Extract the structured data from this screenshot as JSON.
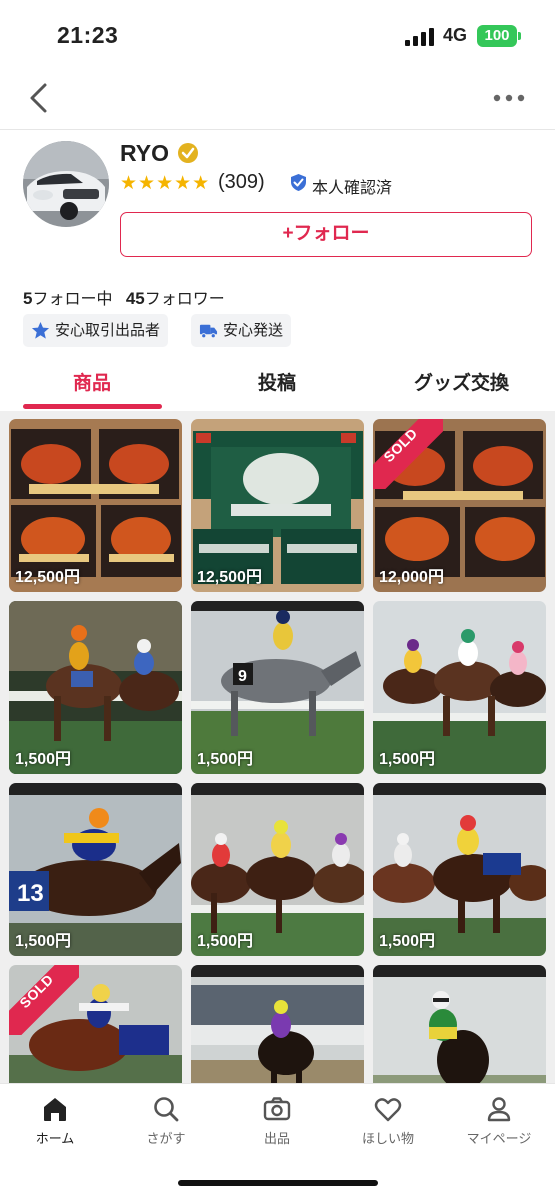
{
  "status_bar": {
    "time": "21:23",
    "network": "4G",
    "battery": "100"
  },
  "profile": {
    "name": "RYO",
    "stars": "★★★★★",
    "review_count": "(309)",
    "identity_label": "本人確認済",
    "follow_button": "+フォロー",
    "following_count": "5",
    "following_label": "フォロー中",
    "follower_count": "45",
    "follower_label": "フォロワー",
    "tags": [
      "安心取引出品者",
      "安心発送"
    ]
  },
  "tabs": [
    "商品",
    "投稿",
    "グッズ交換"
  ],
  "active_tab": "商品",
  "items": [
    {
      "price": "12,500円",
      "sold": false,
      "kind": "box-red"
    },
    {
      "price": "12,500円",
      "sold": false,
      "kind": "box-green"
    },
    {
      "price": "12,000円",
      "sold": true,
      "sold_label": "SOLD",
      "kind": "box-red"
    },
    {
      "price": "1,500円",
      "sold": false,
      "kind": "race"
    },
    {
      "price": "1,500円",
      "sold": false,
      "kind": "race"
    },
    {
      "price": "1,500円",
      "sold": false,
      "kind": "race"
    },
    {
      "price": "1,500円",
      "sold": false,
      "kind": "race"
    },
    {
      "price": "1,500円",
      "sold": false,
      "kind": "race"
    },
    {
      "price": "1,500円",
      "sold": false,
      "kind": "race"
    },
    {
      "price": "",
      "sold": true,
      "sold_label": "SOLD",
      "kind": "race"
    },
    {
      "price": "",
      "sold": false,
      "kind": "race"
    },
    {
      "price": "",
      "sold": false,
      "kind": "race"
    }
  ],
  "bottom_nav": [
    {
      "label": "ホーム",
      "icon": "home-icon",
      "active": true
    },
    {
      "label": "さがす",
      "icon": "search-icon",
      "active": false
    },
    {
      "label": "出品",
      "icon": "camera-icon",
      "active": false
    },
    {
      "label": "ほしい物",
      "icon": "heart-icon",
      "active": false
    },
    {
      "label": "マイページ",
      "icon": "person-icon",
      "active": false
    }
  ],
  "colors": {
    "accent": "#e0284f",
    "star": "#f5b400",
    "verified": "#3b6fd6"
  }
}
